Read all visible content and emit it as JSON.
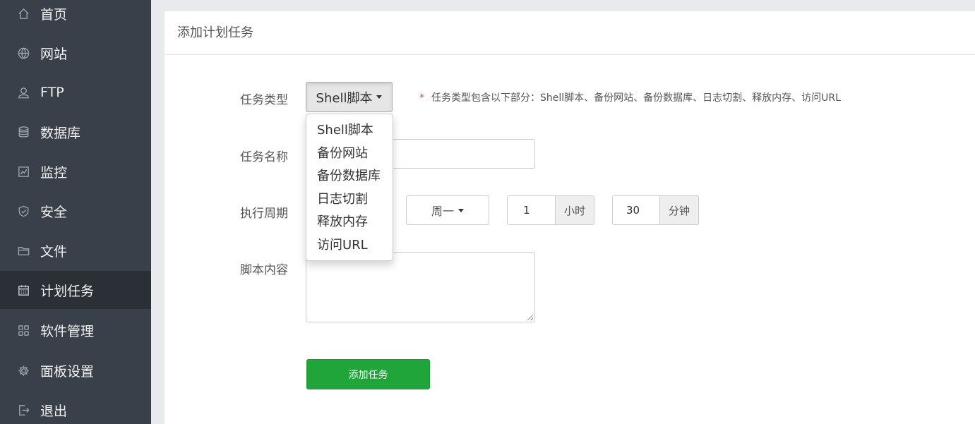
{
  "sidebar": {
    "items": [
      {
        "label": "首页",
        "icon": "home-icon",
        "active": false
      },
      {
        "label": "网站",
        "icon": "globe-icon",
        "active": false
      },
      {
        "label": "FTP",
        "icon": "ftp-user-icon",
        "active": false
      },
      {
        "label": "数据库",
        "icon": "database-icon",
        "active": false
      },
      {
        "label": "监控",
        "icon": "monitor-chart-icon",
        "active": false
      },
      {
        "label": "安全",
        "icon": "shield-icon",
        "active": false
      },
      {
        "label": "文件",
        "icon": "folder-icon",
        "active": false
      },
      {
        "label": "计划任务",
        "icon": "calendar-icon",
        "active": true
      },
      {
        "label": "软件管理",
        "icon": "apps-grid-icon",
        "active": false
      },
      {
        "label": "面板设置",
        "icon": "gear-icon",
        "active": false
      },
      {
        "label": "退出",
        "icon": "logout-icon",
        "active": false
      }
    ]
  },
  "panel": {
    "title": "添加计划任务"
  },
  "form": {
    "task_type": {
      "label": "任务类型",
      "selected": "Shell脚本",
      "hint_star": "*",
      "hint": "任务类型包含以下部分：Shell脚本、备份网站、备份数据库、日志切割、释放内存、访问URL",
      "options": [
        "Shell脚本",
        "备份网站",
        "备份数据库",
        "日志切割",
        "释放内存",
        "访问URL"
      ]
    },
    "task_name": {
      "label": "任务名称",
      "value": ""
    },
    "cycle": {
      "label": "执行周期",
      "week_selected": "周一",
      "hour_value": "1",
      "hour_unit": "小时",
      "minute_value": "30",
      "minute_unit": "分钟"
    },
    "script": {
      "label": "脚本内容",
      "value": ""
    },
    "submit_label": "添加任务"
  },
  "colors": {
    "sidebar_bg": "#394049",
    "sidebar_active_bg": "#2b3037",
    "submit_green": "#20a53a",
    "required_star": "#e8403e"
  }
}
